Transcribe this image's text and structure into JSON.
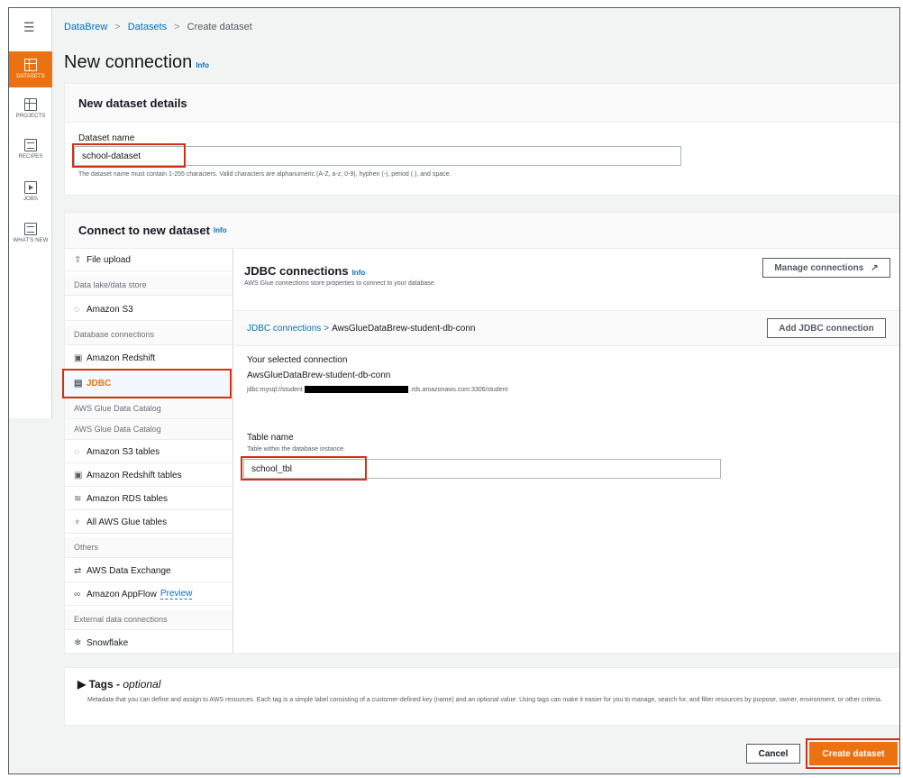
{
  "breadcrumb": {
    "items": [
      "DataBrew",
      "Datasets",
      "Create dataset"
    ]
  },
  "page": {
    "title": "New connection",
    "info": "Info"
  },
  "sidebar": {
    "items": [
      {
        "label": "DATASETS",
        "icon": "datasets-icon",
        "active": true
      },
      {
        "label": "PROJECTS",
        "icon": "projects-icon"
      },
      {
        "label": "RECIPES",
        "icon": "recipes-icon"
      },
      {
        "label": "JOBS",
        "icon": "jobs-icon"
      },
      {
        "label": "WHAT'S NEW",
        "icon": "whats-new-icon"
      }
    ]
  },
  "details": {
    "header": "New dataset details",
    "name_label": "Dataset name",
    "name_value": "school-dataset",
    "name_hint": "The dataset name must contain 1-255 characters. Valid characters are alphanumeric (A-Z, a-z, 0-9), hyphen (-), period (.), and space."
  },
  "connect": {
    "header": "Connect to new dataset",
    "info": "Info",
    "list": [
      {
        "label": "File upload",
        "type": "item",
        "icon": "upload-icon"
      },
      {
        "label": "Data lake/data store",
        "type": "group"
      },
      {
        "label": "Amazon S3",
        "type": "item",
        "icon": "bucket-icon"
      },
      {
        "label": "Database connections",
        "type": "group"
      },
      {
        "label": "Amazon Redshift",
        "type": "item",
        "icon": "redshift-icon"
      },
      {
        "label": "JDBC",
        "type": "item",
        "icon": "jdbc-icon",
        "active": true
      },
      {
        "label": "AWS Glue Data Catalog",
        "type": "group"
      },
      {
        "label": "AWS Glue Data Catalog",
        "type": "group"
      },
      {
        "label": "Amazon S3 tables",
        "type": "item",
        "icon": "bucket-icon"
      },
      {
        "label": "Amazon Redshift tables",
        "type": "item",
        "icon": "redshift-icon"
      },
      {
        "label": "Amazon RDS tables",
        "type": "item",
        "icon": "rds-icon"
      },
      {
        "label": "All AWS Glue tables",
        "type": "item",
        "icon": "glue-icon"
      },
      {
        "label": "Others",
        "type": "group"
      },
      {
        "label": "AWS Data Exchange",
        "type": "item",
        "icon": "exchange-icon"
      },
      {
        "label": "Amazon AppFlow",
        "type": "item",
        "icon": "appflow-icon",
        "extra": "Preview"
      },
      {
        "label": "External data connections",
        "type": "group"
      },
      {
        "label": "Snowflake",
        "type": "item",
        "icon": "snowflake-icon"
      }
    ]
  },
  "jdbc": {
    "title": "JDBC connections",
    "info": "Info",
    "desc": "AWS Glue connections store properties to connect to your database.",
    "manage_btn": "Manage connections",
    "crumb_link": "JDBC connections",
    "crumb_current": "AwsGlueDataBrew-student-db-conn",
    "add_btn": "Add JDBC connection",
    "selected_label": "Your selected connection",
    "selected_name": "AwsGlueDataBrew-student-db-conn",
    "url_prefix": "jdbc:mysql://student",
    "url_suffix": ".rds.amazonaws.com:3306/student",
    "table_label": "Table name",
    "table_hint": "Table within the database instance.",
    "table_value": "school_tbl"
  },
  "tags": {
    "title": "Tags -",
    "optional": "optional",
    "desc": "Metadata that you can define and assign to AWS resources. Each tag is a simple label consisting of a customer-defined key (name) and an optional value. Using tags can make it easier for you to manage, search for, and filter resources by purpose, owner, environment, or other criteria."
  },
  "footer": {
    "cancel": "Cancel",
    "create": "Create dataset"
  },
  "colors": {
    "accent": "#ec7211",
    "link": "#0073bb",
    "highlight": "#d13212"
  }
}
